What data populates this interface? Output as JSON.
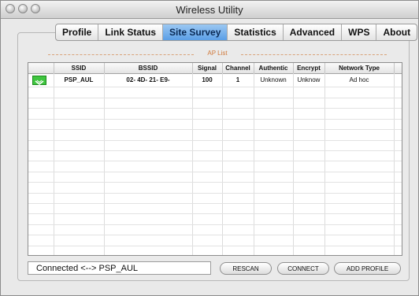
{
  "window": {
    "title": "Wireless Utility"
  },
  "tabs": [
    "Profile",
    "Link Status",
    "Site Survey",
    "Statistics",
    "Advanced",
    "WPS",
    "About"
  ],
  "active_tab": "Site Survey",
  "ap_list": {
    "label": "AP List",
    "columns": [
      "SSID",
      "BSSID",
      "Signal",
      "Channel",
      "Authentic",
      "Encrypt",
      "Network Type"
    ],
    "rows": [
      {
        "ssid": "PSP_AUL",
        "bssid": "02- 4D- 21- E9-",
        "signal": "100",
        "channel": "1",
        "authentic": "Unknown",
        "encrypt": "Unknow",
        "network_type": "Ad hoc"
      }
    ]
  },
  "status": {
    "text": "Connected <--> PSP_AUL"
  },
  "buttons": {
    "rescan": "RESCAN",
    "connect": "CONNECT",
    "add_profile": "ADD PROFILE"
  },
  "colors": {
    "active_tab": "#5a9ee6",
    "ap_icon": "#3fc53f",
    "ap_list_label": "#d07a3c"
  }
}
